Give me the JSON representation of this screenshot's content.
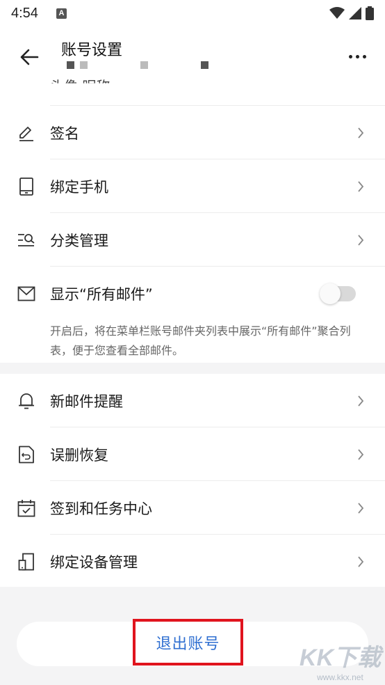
{
  "status_bar": {
    "time": "4:54",
    "notif_glyph": "A",
    "icons": [
      "wifi-icon",
      "signal-icon",
      "battery-icon"
    ]
  },
  "header": {
    "title": "账号设置"
  },
  "partial_row": {
    "label": "头像 昵称"
  },
  "rows": [
    {
      "label": "签名",
      "icon": "pen-icon"
    },
    {
      "label": "绑定手机",
      "icon": "phone-icon"
    },
    {
      "label": "分类管理",
      "icon": "category-search-icon"
    },
    {
      "label": "显示“所有邮件”",
      "icon": "mail-icon",
      "toggle": false
    }
  ],
  "show_all_mail_desc": "开启后，将在菜单栏账号邮件夹列表中展示“所有邮件”聚合列表，便于您查看全部邮件。",
  "rows2": [
    {
      "label": "新邮件提醒",
      "icon": "bell-icon"
    },
    {
      "label": "误删恢复",
      "icon": "restore-icon"
    },
    {
      "label": "签到和任务中心",
      "icon": "calendar-check-icon"
    },
    {
      "label": "绑定设备管理",
      "icon": "devices-icon"
    }
  ],
  "logout_label": "退出账号",
  "watermark": {
    "logo": "KK下载",
    "url": "www.kkx.net"
  },
  "colors": {
    "accent_blue": "#2f6fd1",
    "highlight_red": "#e0141e",
    "section_bg": "#f4f4f5"
  }
}
